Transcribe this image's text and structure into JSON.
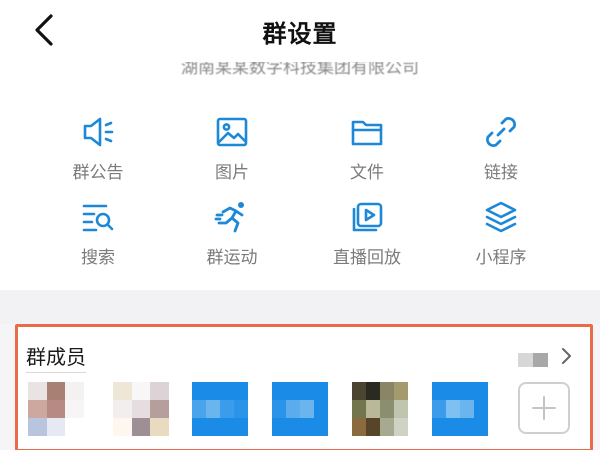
{
  "header": {
    "title": "群设置"
  },
  "org": {
    "name": "湖南某某数字科技集团有限公司"
  },
  "tools": [
    {
      "label": "群公告",
      "icon": "megaphone-icon"
    },
    {
      "label": "图片",
      "icon": "image-icon"
    },
    {
      "label": "文件",
      "icon": "folder-icon"
    },
    {
      "label": "链接",
      "icon": "link-icon"
    },
    {
      "label": "搜索",
      "icon": "search-list-icon"
    },
    {
      "label": "群运动",
      "icon": "running-icon"
    },
    {
      "label": "直播回放",
      "icon": "video-playback-icon"
    },
    {
      "label": "小程序",
      "icon": "layers-icon"
    }
  ],
  "members": {
    "title": "群成员"
  },
  "colors": {
    "accent": "#1e88d8",
    "highlight_border": "#ea6b4a"
  }
}
